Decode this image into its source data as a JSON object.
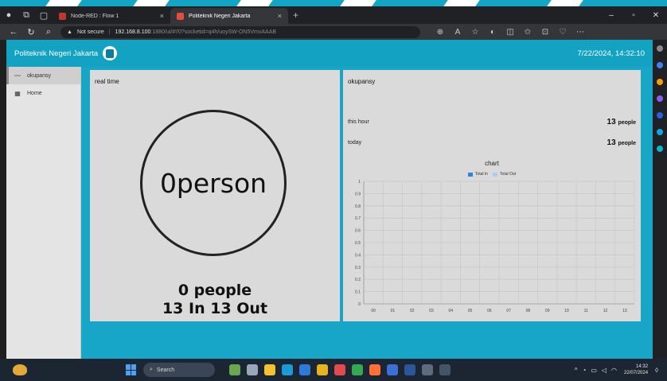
{
  "browser": {
    "tabs": [
      {
        "label": "Node-RED : Flow 1",
        "close": "×",
        "active": false
      },
      {
        "label": "Politeknik Negeri Jakarta",
        "close": "×",
        "active": true
      }
    ],
    "new_tab": "+",
    "url": {
      "security": "Not secure",
      "host": "192.168.8.100",
      "path": ":1880/ui/#!/0?socketid=q4h/uoySW-ON5VmvAAAB"
    }
  },
  "app": {
    "title": "Politeknik Negeri Jakarta",
    "datetime": "7/22/2024, 14:32:10"
  },
  "sidebar": {
    "items": [
      {
        "label": "okupansy",
        "icon": "chart-line-icon",
        "active": true
      },
      {
        "label": "Home",
        "icon": "grid-icon",
        "active": false
      }
    ]
  },
  "realtime": {
    "title": "real time",
    "gauge_text": "0person",
    "people_line": "0 people",
    "inout_line": "13 In 13 Out"
  },
  "okupansy": {
    "title": "okupansy",
    "rows": [
      {
        "label": "this hour",
        "value": "13",
        "unit": "people"
      },
      {
        "label": "today",
        "value": "13",
        "unit": "people"
      }
    ]
  },
  "chart_data": {
    "type": "bar",
    "title": "chart",
    "series": [
      {
        "name": "Total In",
        "color": "#2e86d6",
        "values": []
      },
      {
        "name": "Total Out",
        "color": "#a9cdee",
        "values": []
      }
    ],
    "categories": [
      "00",
      "01",
      "02",
      "03",
      "04",
      "05",
      "06",
      "07",
      "08",
      "09",
      "10",
      "11",
      "12",
      "13"
    ],
    "y_ticks": [
      "0",
      "0.1",
      "0.2",
      "0.3",
      "0.4",
      "0.5",
      "0.6",
      "0.7",
      "0.8",
      "0.9",
      "1"
    ],
    "ylim": [
      0,
      1
    ],
    "grid": true,
    "legend": "top"
  },
  "taskbar": {
    "search_placeholder": "Search",
    "time": "14:32",
    "date": "22/07/2024"
  }
}
